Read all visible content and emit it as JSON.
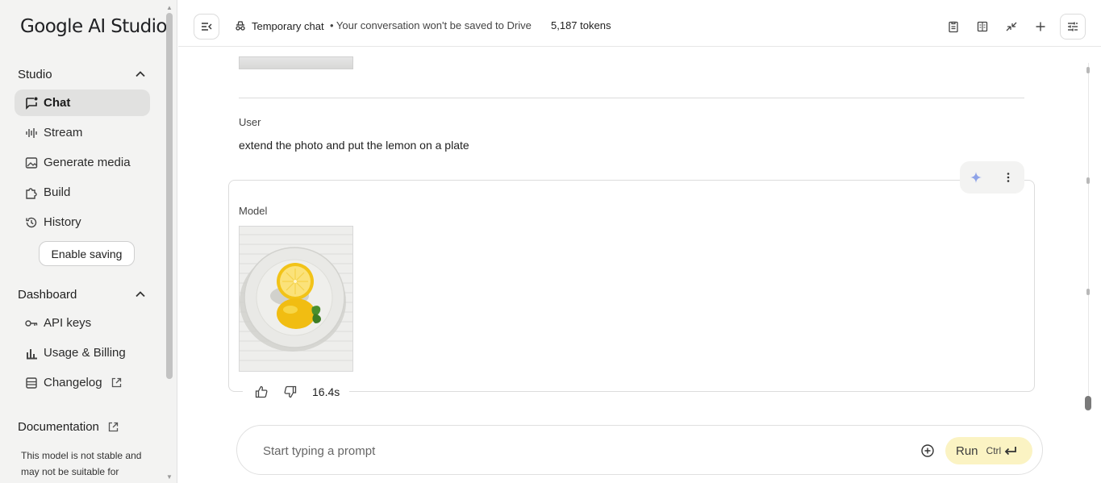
{
  "app": {
    "logo": "Google AI Studio"
  },
  "sidebar": {
    "studio_section": "Studio",
    "studio_items": [
      {
        "label": "Chat",
        "icon": "chat-icon",
        "active": true
      },
      {
        "label": "Stream",
        "icon": "stream-icon"
      },
      {
        "label": "Generate media",
        "icon": "image-icon"
      },
      {
        "label": "Build",
        "icon": "puzzle-icon"
      },
      {
        "label": "History",
        "icon": "history-icon"
      }
    ],
    "enable_saving": "Enable saving",
    "dashboard_section": "Dashboard",
    "dashboard_items": [
      {
        "label": "API keys",
        "icon": "key-icon"
      },
      {
        "label": "Usage & Billing",
        "icon": "bar-chart-icon"
      },
      {
        "label": "Changelog",
        "icon": "changelog-icon",
        "external": true
      }
    ],
    "documentation": "Documentation",
    "note": "This model is not stable and may not be suitable for"
  },
  "topbar": {
    "temp_chat": "Temporary chat",
    "temp_note": "• Your conversation won't be saved to Drive",
    "tokens": "5,187 tokens",
    "icons": [
      "clipboard-icon",
      "compare-icon",
      "collapse-icon",
      "new-chat-icon",
      "settings-tune-icon"
    ]
  },
  "conversation": {
    "user_role": "User",
    "user_message": "extend the photo and put the lemon on a plate",
    "model_role": "Model",
    "response_time": "16.4s"
  },
  "prompt": {
    "placeholder": "Start typing a prompt",
    "run_label": "Run",
    "run_shortcut": "Ctrl"
  },
  "colors": {
    "run_button_bg": "#fbf3c3",
    "sidebar_bg": "#f3f3f2",
    "active_nav_bg": "#e1e1e0",
    "sparkle": "#8ea3e8"
  }
}
